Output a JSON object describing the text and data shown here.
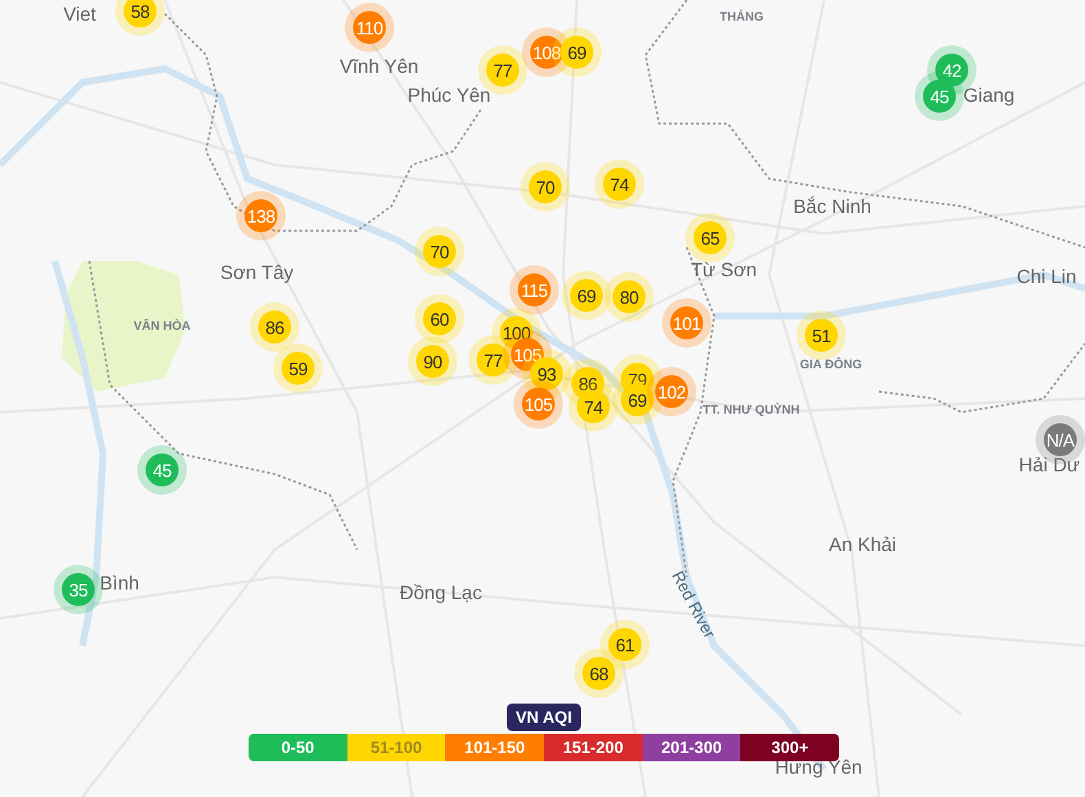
{
  "places": [
    {
      "name": "Viet",
      "kind": "city"
    },
    {
      "name": "Vĩnh Yên",
      "kind": "city"
    },
    {
      "name": "Phúc Yên",
      "kind": "city"
    },
    {
      "name": "THÁNG",
      "kind": "district"
    },
    {
      "name": "Giang",
      "kind": "city"
    },
    {
      "name": "Bắc Ninh",
      "kind": "city"
    },
    {
      "name": "Sơn Tây",
      "kind": "city"
    },
    {
      "name": "VÂN HÒA",
      "kind": "district"
    },
    {
      "name": "Từ Sơn",
      "kind": "city"
    },
    {
      "name": "Chi Lin",
      "kind": "city"
    },
    {
      "name": "GIA ĐÔNG",
      "kind": "district"
    },
    {
      "name": "TT. NHƯ QUỲNH",
      "kind": "district"
    },
    {
      "name": "Hải Dư",
      "kind": "city"
    },
    {
      "name": "An Khải",
      "kind": "city"
    },
    {
      "name": "Bình",
      "kind": "city"
    },
    {
      "name": "Đồng Lạc",
      "kind": "city"
    },
    {
      "name": "Red River",
      "kind": "river"
    },
    {
      "name": "Hưng Yên",
      "kind": "city"
    }
  ],
  "markers": [
    {
      "value": "58",
      "color": "#ffd600"
    },
    {
      "value": "110",
      "color": "#ff7e00"
    },
    {
      "value": "77",
      "color": "#ffd600"
    },
    {
      "value": "108",
      "color": "#ff7e00"
    },
    {
      "value": "69",
      "color": "#ffd600"
    },
    {
      "value": "42",
      "color": "#1fbd5a"
    },
    {
      "value": "45",
      "color": "#1fbd5a"
    },
    {
      "value": "70",
      "color": "#ffd600"
    },
    {
      "value": "74",
      "color": "#ffd600"
    },
    {
      "value": "138",
      "color": "#ff7e00"
    },
    {
      "value": "70",
      "color": "#ffd600"
    },
    {
      "value": "65",
      "color": "#ffd600"
    },
    {
      "value": "115",
      "color": "#ff7e00"
    },
    {
      "value": "69",
      "color": "#ffd600"
    },
    {
      "value": "80",
      "color": "#ffd600"
    },
    {
      "value": "86",
      "color": "#ffd600"
    },
    {
      "value": "60",
      "color": "#ffd600"
    },
    {
      "value": "100",
      "color": "#ffd600"
    },
    {
      "value": "101",
      "color": "#ff7e00"
    },
    {
      "value": "51",
      "color": "#ffd600"
    },
    {
      "value": "59",
      "color": "#ffd600"
    },
    {
      "value": "90",
      "color": "#ffd600"
    },
    {
      "value": "77",
      "color": "#ffd600"
    },
    {
      "value": "105",
      "color": "#ff7e00"
    },
    {
      "value": "93",
      "color": "#ffd600"
    },
    {
      "value": "86",
      "color": "#ffd600"
    },
    {
      "value": "79",
      "color": "#ffd600"
    },
    {
      "value": "105",
      "color": "#ff7e00"
    },
    {
      "value": "74",
      "color": "#ffd600"
    },
    {
      "value": "69",
      "color": "#ffd600"
    },
    {
      "value": "102",
      "color": "#ff7e00"
    },
    {
      "value": "N/A",
      "color": "#7a7a7a"
    },
    {
      "value": "45",
      "color": "#1fbd5a"
    },
    {
      "value": "35",
      "color": "#1fbd5a"
    },
    {
      "value": "61",
      "color": "#ffd600"
    },
    {
      "value": "68",
      "color": "#ffd600"
    }
  ],
  "legend": {
    "title": "VN AQI",
    "bands": [
      {
        "label": "0-50",
        "color": "#1fbd5a"
      },
      {
        "label": "51-100",
        "color": "#ffd600"
      },
      {
        "label": "101-150",
        "color": "#ff7e00"
      },
      {
        "label": "151-200",
        "color": "#d92b2b"
      },
      {
        "label": "201-300",
        "color": "#8e3fa0"
      },
      {
        "label": "300+",
        "color": "#7e0023"
      }
    ]
  }
}
